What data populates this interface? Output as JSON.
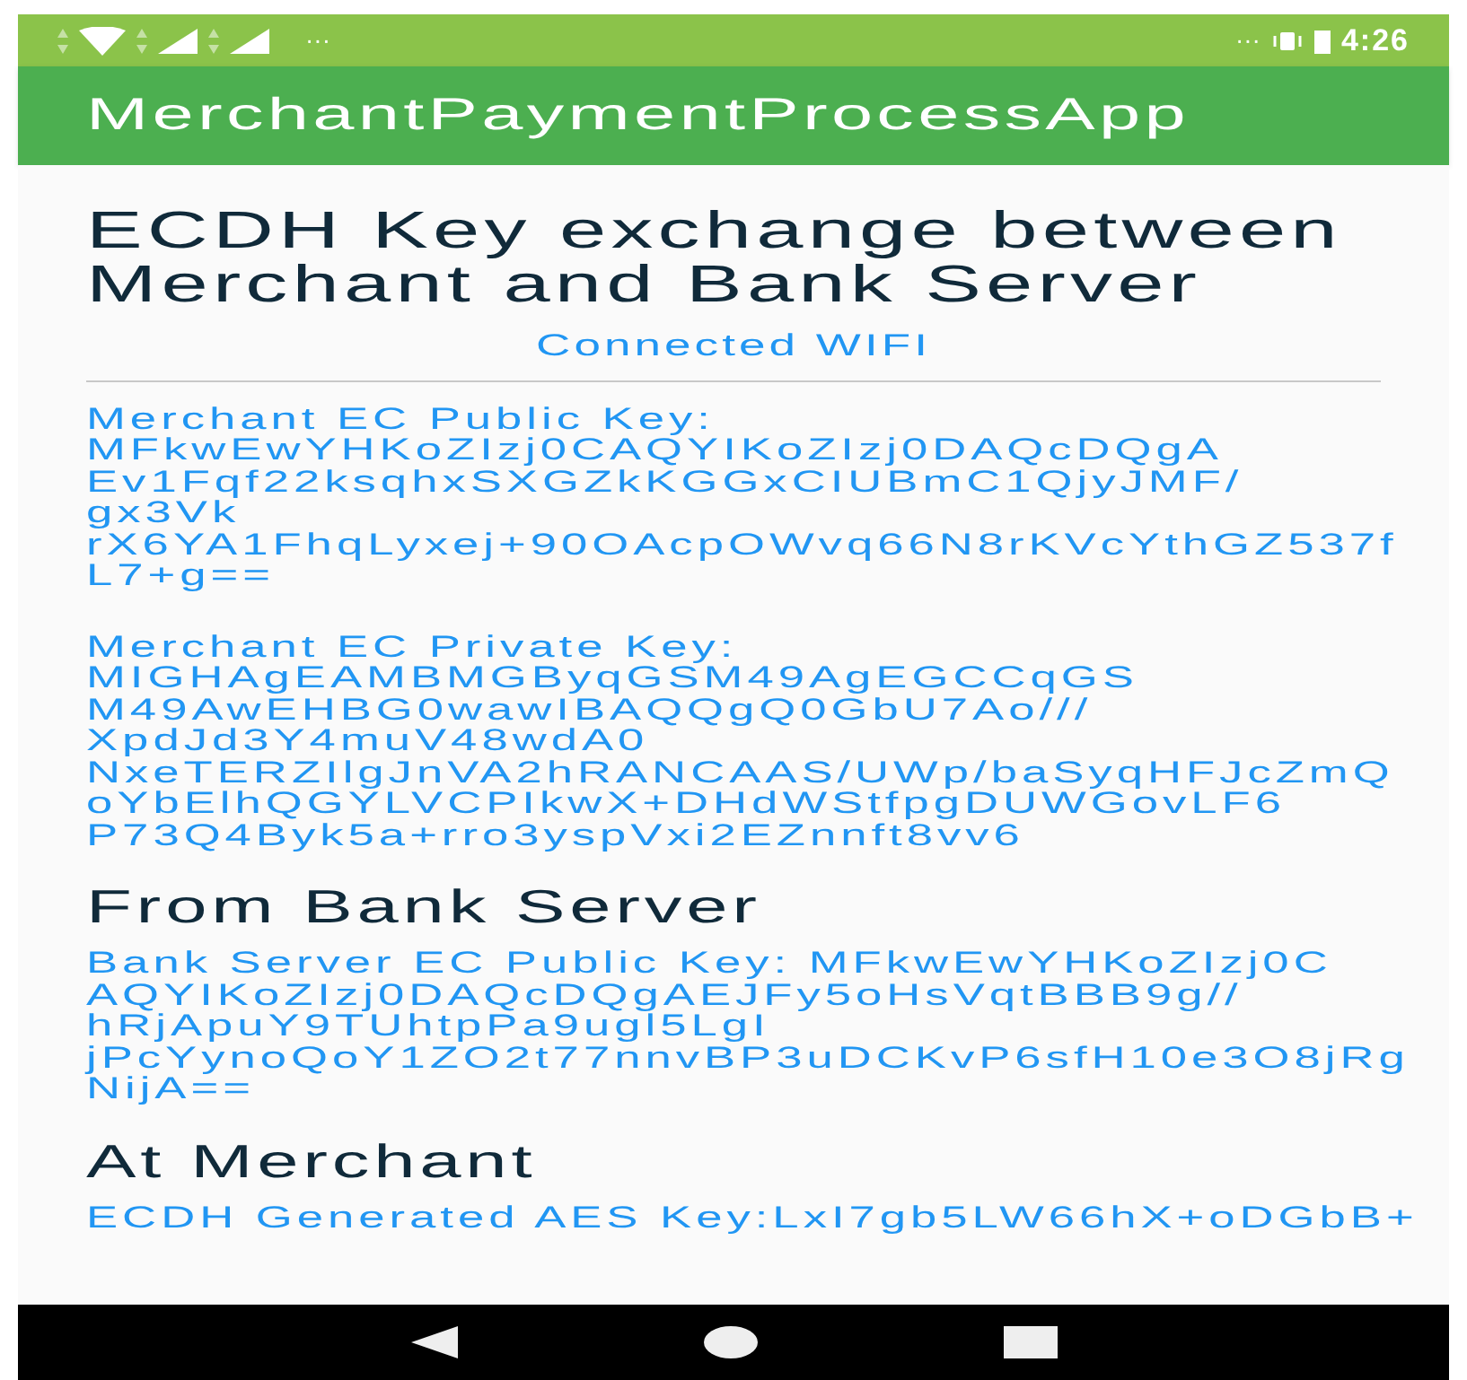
{
  "status_bar": {
    "time": "4:26",
    "notif_dots": "···",
    "right_dots": "···"
  },
  "app_bar": {
    "title": "MerchantPaymentProcessApp"
  },
  "heading": [
    "ECDH Key exchange between",
    "Merchant and Bank Server"
  ],
  "connection_status": "Connected WIFI",
  "sections": [
    {
      "kind": "keys",
      "blocks": [
        {
          "lines": [
            "Merchant EC Public Key:",
            "MFkwEwYHKoZIzj0CAQYIKoZIzj0DAQcDQgA",
            "Ev1Fqf22ksqhxSXGZkKGGxCIUBmC1QjyJMF/",
            "gx3Vk",
            "rX6YA1FhqLyxej+90OAcpOWvq66N8rKVcYthGZ537f",
            "L7+g=="
          ]
        },
        {
          "lines": [
            "Merchant EC Private Key:",
            "MIGHAgEAMBMGByqGSM49AgEGCCqGS",
            "M49AwEHBG0wawIBAQQgQ0GbU7Ao///",
            "XpdJd3Y4muV48wdA0",
            "NxeTERZIlgJnVA2hRANCAAS/UWp/baSyqHFJcZmQ",
            "oYbElhQGYLVCPIkwX+DHdWStfpgDUWGovLF6",
            "P73Q4Byk5a+rro3yspVxi2EZnnft8vv6"
          ]
        }
      ]
    },
    {
      "kind": "keys",
      "heading": "From Bank Server",
      "blocks": [
        {
          "lines": [
            "Bank Server EC Public Key: MFkwEwYHKoZIzj0C",
            "AQYIKoZIzj0DAQcDQgAEJFy5oHsVqtBBB9g//",
            "hRjApuY9TUhtpPa9ugl5LgI",
            "jPcYynoQoY1ZO2t77nnvBP3uDCKvP6sfH10e3O8jRg",
            "NijA=="
          ]
        }
      ]
    },
    {
      "kind": "keys",
      "heading": "At Merchant",
      "blocks": [
        {
          "lines": [
            "ECDH Generated AES Key:LxI7gb5LW66hX+oDGbB+"
          ]
        }
      ]
    }
  ]
}
